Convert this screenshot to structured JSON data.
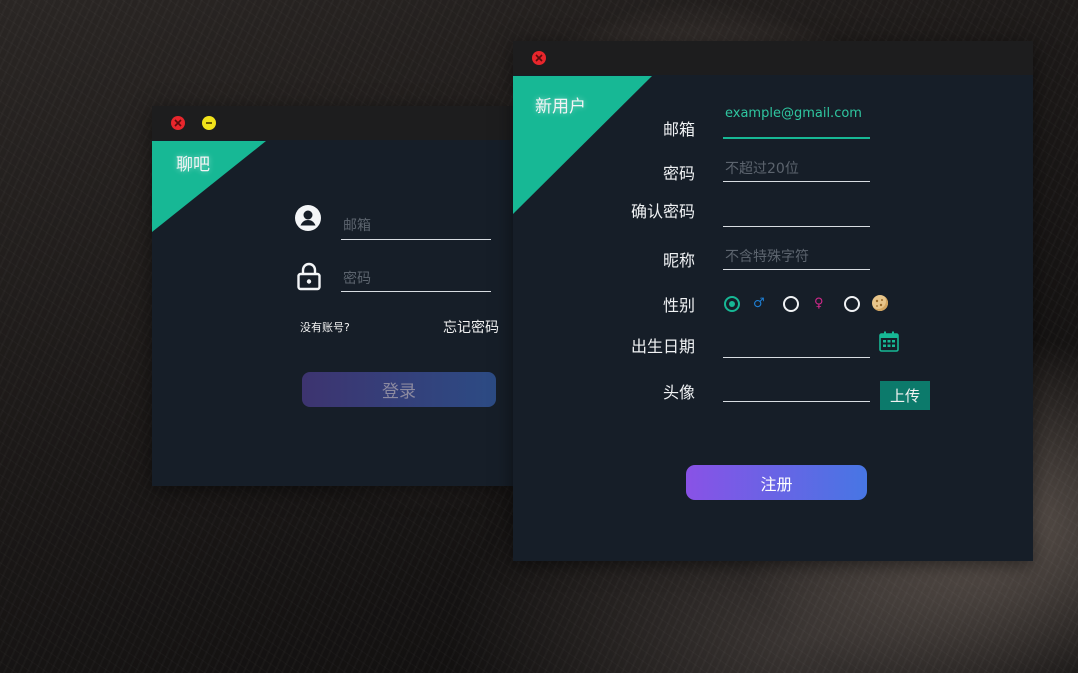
{
  "login": {
    "corner_title": "聊吧",
    "email_placeholder": "邮箱",
    "password_placeholder": "密码",
    "no_account_link": "没有账号?",
    "forgot_password_link": "忘记密码",
    "login_button": "登录",
    "icons": [
      "close-icon",
      "minimize-icon",
      "user-icon",
      "lock-icon"
    ]
  },
  "register": {
    "corner_title": "新用户",
    "labels": {
      "email": "邮箱",
      "password": "密码",
      "confirm_password": "确认密码",
      "nickname": "昵称",
      "gender": "性别",
      "birth_date": "出生日期",
      "avatar": "头像"
    },
    "placeholders": {
      "email": "example@gmail.com",
      "password": "不超过20位",
      "confirm_password": "",
      "nickname": "不含特殊字符",
      "birth_date": "",
      "avatar": ""
    },
    "gender_options": [
      {
        "icon": "male-icon",
        "symbol": "♂",
        "color": "#1e7fd4",
        "selected": true
      },
      {
        "icon": "female-icon",
        "symbol": "♀",
        "color": "#d0288a",
        "selected": false
      },
      {
        "icon": "other-gender-icon",
        "symbol": "●",
        "color": "#e9c27a",
        "selected": false
      }
    ],
    "upload_button": "上传",
    "register_button": "注册",
    "icons": [
      "close-icon",
      "calendar-icon"
    ]
  },
  "colors": {
    "accent": "#17b895",
    "window_bg": "#161e28",
    "titlebar_bg": "#1d1d1e",
    "close": "#e8262c",
    "minimize": "#f2e31a",
    "upload_bg": "#0c7a6b"
  }
}
